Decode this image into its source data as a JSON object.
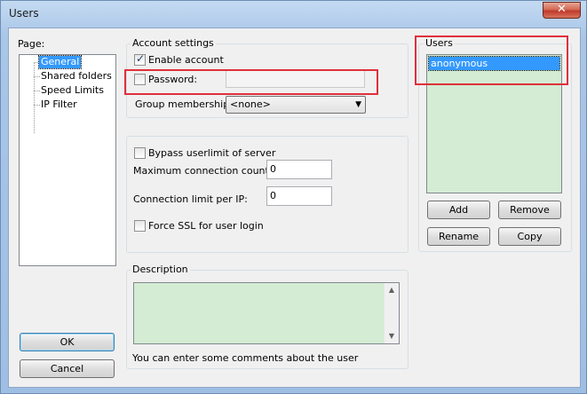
{
  "window": {
    "title": "Users",
    "close_glyph": "✕"
  },
  "page_panel": {
    "label": "Page:",
    "items": [
      "General",
      "Shared folders",
      "Speed Limits",
      "IP Filter"
    ],
    "selected_index": 0
  },
  "buttons": {
    "ok": "OK",
    "cancel": "Cancel",
    "add": "Add",
    "remove": "Remove",
    "rename": "Rename",
    "copy": "Copy"
  },
  "account": {
    "group_label": "Account settings",
    "enable_label": "Enable account",
    "enable_checked": true,
    "password_label": "Password:",
    "password_checked": false,
    "password_value": "",
    "group_membership_label": "Group membership:",
    "group_membership_value": "<none>"
  },
  "limits": {
    "bypass_label": "Bypass userlimit of server",
    "bypass_checked": false,
    "max_conn_label": "Maximum connection count:",
    "max_conn_value": "0",
    "conn_per_ip_label": "Connection limit per IP:",
    "conn_per_ip_value": "0",
    "force_ssl_label": "Force SSL for user login",
    "force_ssl_checked": false
  },
  "description": {
    "group_label": "Description",
    "value": "",
    "hint": "You can enter some comments about the user"
  },
  "users": {
    "group_label": "Users",
    "list": [
      "anonymous"
    ],
    "selected_index": 0
  },
  "icons": {
    "check": "✓",
    "dropdown": "▼",
    "scroll_up": "▲",
    "scroll_down": "▼"
  },
  "colors": {
    "highlight": "#e0303a",
    "selection": "#3399ff",
    "list_background": "#d3ecd3"
  }
}
